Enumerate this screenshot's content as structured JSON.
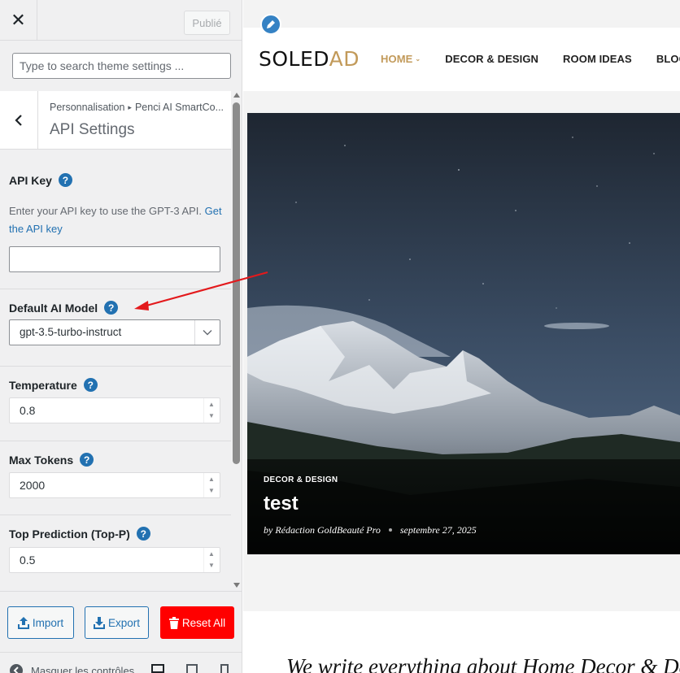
{
  "topbar": {
    "close_glyph": "✕",
    "publish_label": "Publié"
  },
  "search": {
    "placeholder": "Type to search theme settings ..."
  },
  "panel": {
    "breadcrumb_root": "Personnalisation",
    "breadcrumb_section": "Penci AI SmartCo...",
    "title": "API Settings"
  },
  "fields": {
    "api_key": {
      "label": "API Key",
      "desc_text": "Enter your API key to use the GPT-3 API.",
      "desc_link": "Get the API key",
      "value": ""
    },
    "ai_model": {
      "label": "Default AI Model",
      "value": "gpt-3.5-turbo-instruct"
    },
    "temperature": {
      "label": "Temperature",
      "value": "0.8"
    },
    "max_tokens": {
      "label": "Max Tokens",
      "value": "2000"
    },
    "top_p": {
      "label": "Top Prediction (Top-P)",
      "value": "0.5"
    }
  },
  "actions": {
    "import_label": "Import",
    "export_label": "Export",
    "reset_label": "Reset All"
  },
  "footer": {
    "hide_controls_label": "Masquer les contrôles"
  },
  "preview": {
    "logo_dark": "SOLED",
    "logo_gold": "AD",
    "nav": [
      "HOME",
      "DECOR & DESIGN",
      "ROOM IDEAS",
      "BLOG"
    ],
    "hero": {
      "category": "DECOR & DESIGN",
      "title": "test",
      "author": "by Rédaction GoldBeauté Pro",
      "date": "septembre 27, 2025"
    },
    "tagline": "We write everything about Home Decor & Desi"
  },
  "colors": {
    "accent_blue": "#2271b1",
    "gold": "#c29a5a",
    "reset_red": "#ff0000",
    "annotation_arrow": "#e3191c"
  },
  "icons": [
    "close-icon",
    "back-chevron-icon",
    "help-icon",
    "chevron-down-icon",
    "upload-icon",
    "download-icon",
    "trash-icon",
    "pencil-icon",
    "desktop-icon",
    "tablet-icon",
    "mobile-icon"
  ]
}
